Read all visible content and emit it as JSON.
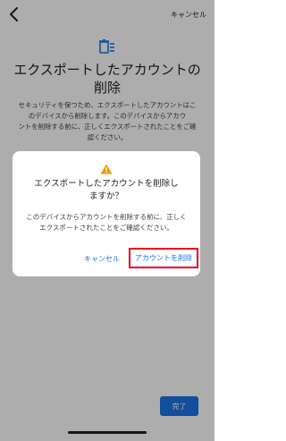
{
  "header": {
    "cancel_label": "キャンセル"
  },
  "page": {
    "title_line1": "エクスポートしたアカウントの",
    "title_line2": "削除",
    "description_line1": "セキュリティを保つため、エクスポートしたアカウントはこ",
    "description_line2": "のデバイスから削除します。このデバイスからアカウ",
    "description_line3": "ントを削除する前に、正しくエクスポートされたことをご確",
    "description_line4": "認ください。",
    "done_label": "完了"
  },
  "dialog": {
    "title_line1": "エクスポートしたアカウントを削除し",
    "title_line2": "ますか？",
    "message_line1": "このデバイスからアカウントを削除する前に、正しく",
    "message_line2": "エクスポートされたことをご確認ください。",
    "cancel_label": "キャンセル",
    "delete_label": "アカウントを削除"
  },
  "colors": {
    "accent": "#1a73e8",
    "warning": "#f29900",
    "highlight": "#e8001e"
  }
}
